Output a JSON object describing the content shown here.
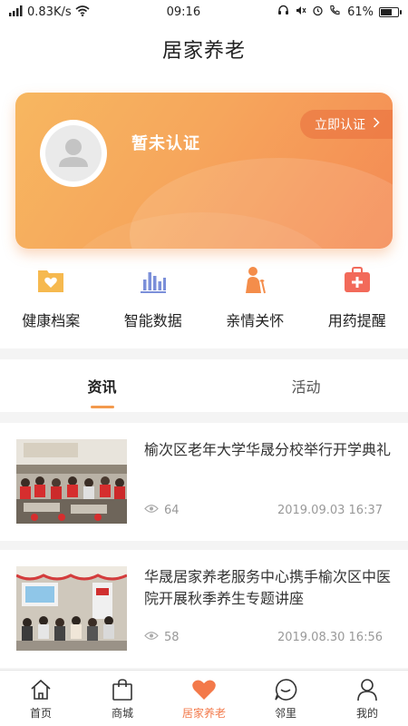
{
  "status_bar": {
    "network_speed": "0.83K/s",
    "time": "09:16",
    "battery": "61%",
    "battery_level": 0.61
  },
  "header": {
    "title": "居家养老"
  },
  "profile": {
    "status": "暂未认证",
    "verify_label": "立即认证"
  },
  "quick_actions": [
    {
      "label": "健康档案",
      "icon": "health-record-icon"
    },
    {
      "label": "智能数据",
      "icon": "smart-data-icon"
    },
    {
      "label": "亲情关怀",
      "icon": "family-care-icon"
    },
    {
      "label": "用药提醒",
      "icon": "medicine-reminder-icon"
    }
  ],
  "tabs": [
    {
      "label": "资讯",
      "active": true
    },
    {
      "label": "活动",
      "active": false
    }
  ],
  "news": [
    {
      "title": "榆次区老年大学华晟分校举行开学典礼",
      "views": "64",
      "date": "2019.09.03 16:37"
    },
    {
      "title": "华晟居家养老服务中心携手榆次区中医院开展秋季养生专题讲座",
      "views": "58",
      "date": "2019.08.30 16:56"
    }
  ],
  "bottom_nav": [
    {
      "label": "首页",
      "icon": "home-icon",
      "active": false
    },
    {
      "label": "商城",
      "icon": "shopping-bag-icon",
      "active": false
    },
    {
      "label": "居家养老",
      "icon": "heart-icon",
      "active": true
    },
    {
      "label": "邻里",
      "icon": "chat-icon",
      "active": false
    },
    {
      "label": "我的",
      "icon": "user-icon",
      "active": false
    }
  ],
  "colors": {
    "accent": "#f3794a",
    "card_start": "#f7b760",
    "card_end": "#f48953",
    "tab_indicator": "#f39a4d"
  }
}
